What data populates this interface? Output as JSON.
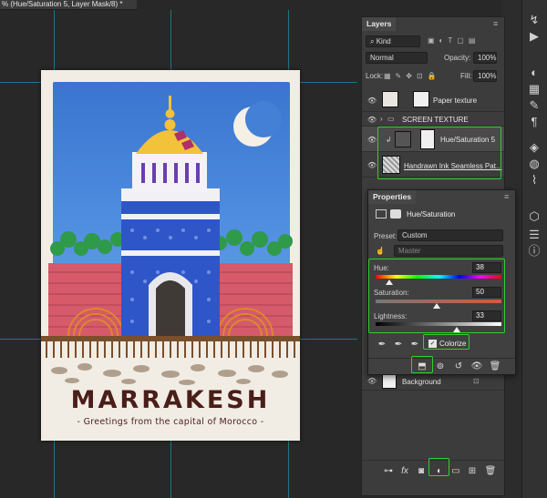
{
  "document": {
    "tab_title": "% (Hue/Saturation 5, Layer Mask/8) *"
  },
  "poster": {
    "title": "MARRAKESH",
    "subtitle": "- Greetings from the capital of Morocco -"
  },
  "layers_panel": {
    "tab_label": "Layers",
    "filter_kind": "Kind",
    "blend_mode": "Normal",
    "opacity_label": "Opacity:",
    "opacity_value": "100%",
    "lock_label": "Lock:",
    "fill_label": "Fill:",
    "fill_value": "100%",
    "layers": [
      {
        "name": "Paper texture"
      },
      {
        "name": "SCREEN TEXTURE"
      },
      {
        "name": "Hue/Saturation 5"
      },
      {
        "name": "Handrawn Ink Seamless Pat..."
      },
      {
        "name": "Background"
      }
    ]
  },
  "properties_panel": {
    "tab_label": "Properties",
    "adjustment_name": "Hue/Saturation",
    "preset_label": "Preset:",
    "preset_value": "Custom",
    "channel_value": "Master",
    "hue_label": "Hue:",
    "hue_value": "38",
    "saturation_label": "Saturation:",
    "saturation_value": "50",
    "lightness_label": "Lightness:",
    "lightness_value": "33",
    "colorize_label": "Colorize",
    "colorize_checked": "✓"
  },
  "icons": {
    "layers_footer": [
      "link-icon",
      "fx-icon",
      "mask-icon",
      "adjustment-icon",
      "folder-icon",
      "new-layer-icon",
      "trash-icon"
    ],
    "props_footer": [
      "clip-icon",
      "view-previous-icon",
      "reset-icon",
      "visibility-icon",
      "trash-icon"
    ]
  },
  "colors": {
    "highlight": "#2fd12f",
    "panel_bg": "#3c3c3c",
    "canvas_bg": "#282828",
    "title_color": "#4a1e1a"
  }
}
